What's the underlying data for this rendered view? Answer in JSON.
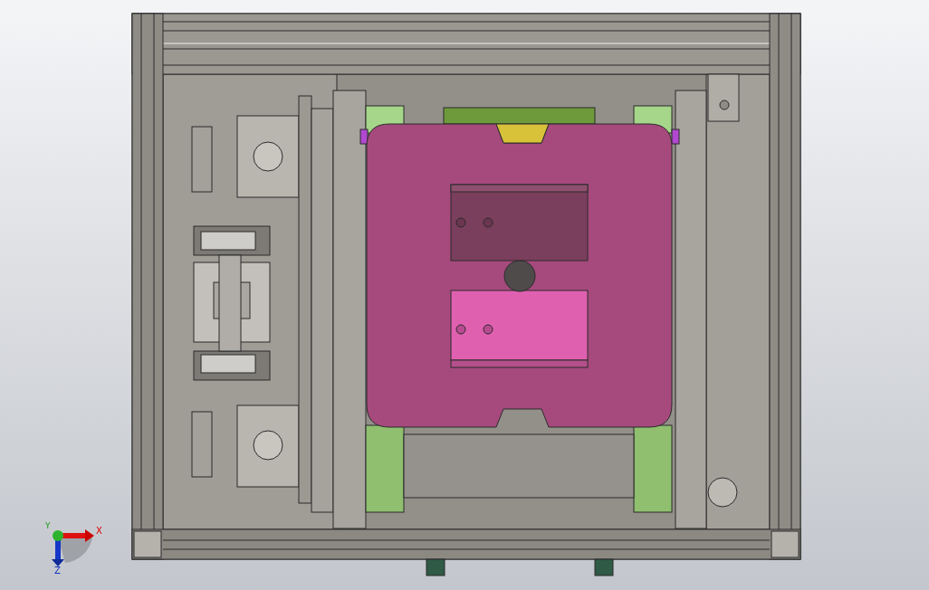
{
  "viewport": {
    "triad": {
      "x_label": "X",
      "y_label": "Y",
      "z_label": "Z"
    }
  }
}
